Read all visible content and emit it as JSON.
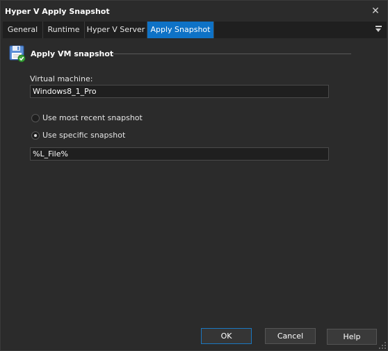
{
  "window": {
    "title": "Hyper V Apply Snapshot",
    "close_glyph": "✕"
  },
  "tabs": [
    {
      "label": "General",
      "active": false
    },
    {
      "label": "Runtime",
      "active": false
    },
    {
      "label": "Hyper V Server",
      "active": false
    },
    {
      "label": "Apply Snapshot",
      "active": true
    }
  ],
  "section": {
    "title": "Apply VM snapshot",
    "icon": "floppy-disk-check-icon"
  },
  "form": {
    "vm_label": "Virtual machine:",
    "vm_value": "Windows8_1_Pro",
    "radio_recent_label": "Use most recent snapshot",
    "radio_recent_checked": false,
    "radio_specific_label": "Use specific snapshot",
    "radio_specific_checked": true,
    "snapshot_value": "%L_File%"
  },
  "buttons": {
    "ok": "OK",
    "cancel": "Cancel",
    "help": "Help"
  },
  "colors": {
    "background": "#2b2b2b",
    "accent": "#0e72c6",
    "field": "#1f1f1f"
  }
}
